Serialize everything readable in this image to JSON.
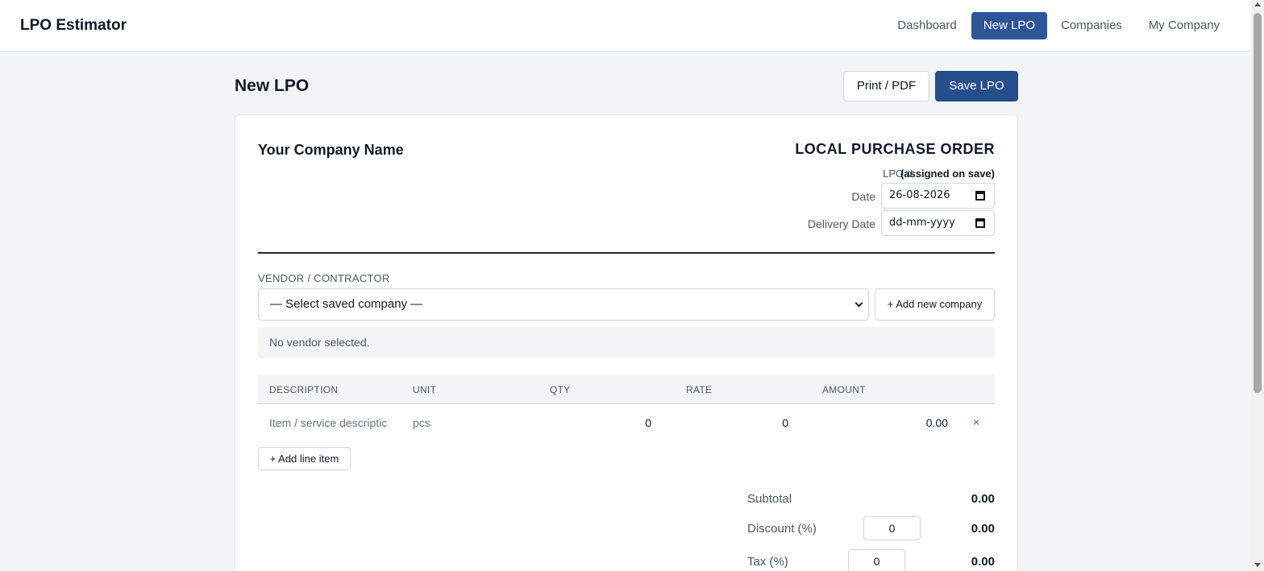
{
  "app": {
    "brand": "LPO Estimator"
  },
  "nav": {
    "dashboard": "Dashboard",
    "new_lpo": "New LPO",
    "companies": "Companies",
    "my_company": "My Company"
  },
  "page": {
    "title": "New LPO",
    "print_label": "Print / PDF",
    "save_label": "Save LPO"
  },
  "doc": {
    "company_name": "Your Company Name",
    "title": "LOCAL PURCHASE ORDER",
    "lpo_label": "LPO #",
    "lpo_value": "(assigned on save)",
    "date_label": "Date",
    "date_value": "26-08-2026",
    "delivery_label": "Delivery Date",
    "delivery_value": "dd-mm-yyyy"
  },
  "vendor": {
    "section_label": "VENDOR / CONTRACTOR",
    "select_value": "— Select saved company —",
    "add_company_label": "+ Add new company",
    "status": "No vendor selected."
  },
  "table": {
    "headers": [
      "DESCRIPTION",
      "UNIT",
      "QTY",
      "RATE",
      "AMOUNT"
    ],
    "rows": [
      {
        "description": "Item / service descriptic",
        "unit": "pcs",
        "qty": "0",
        "rate": "0",
        "amount": "0.00",
        "remove": "×"
      }
    ],
    "add_line_label": "+ Add line item"
  },
  "totals": {
    "subtotal_label": "Subtotal",
    "subtotal_value": "0.00",
    "discount_label": "Discount (%)",
    "discount_input": "0",
    "discount_value": "0.00",
    "tax_label": "Tax (%)",
    "tax_input": "0",
    "tax_value": "0.00"
  },
  "colors": {
    "primary": "#254e8c",
    "nav_active": "#2e5598",
    "remove": "#c2410c"
  }
}
